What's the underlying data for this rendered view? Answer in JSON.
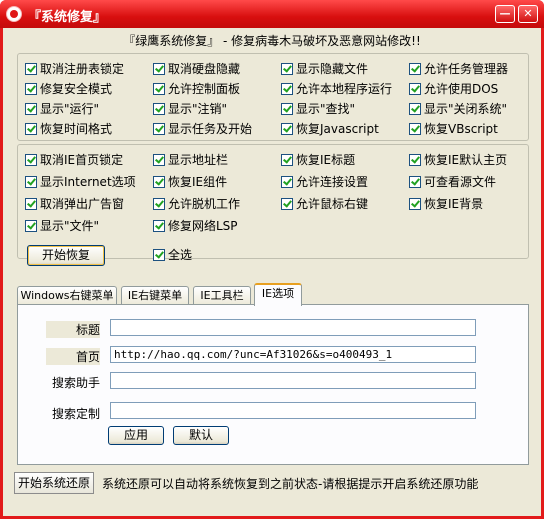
{
  "window": {
    "title": "『系统修复』",
    "minimize": "—",
    "close": "✕"
  },
  "headline": "『绿鹰系统修复』 - 修复病毒木马破坏及恶意网站修改!!",
  "group1": [
    {
      "label": "取消注册表锁定",
      "checked": true
    },
    {
      "label": "取消硬盘隐藏",
      "checked": true
    },
    {
      "label": "显示隐藏文件",
      "checked": true
    },
    {
      "label": "允许任务管理器",
      "checked": true
    },
    {
      "label": "修复安全模式",
      "checked": true
    },
    {
      "label": "允许控制面板",
      "checked": true
    },
    {
      "label": "允许本地程序运行",
      "checked": true
    },
    {
      "label": "允许使用DOS",
      "checked": true
    },
    {
      "label": "显示\"运行\"",
      "checked": true
    },
    {
      "label": "显示\"注销\"",
      "checked": true
    },
    {
      "label": "显示\"查找\"",
      "checked": true
    },
    {
      "label": "显示\"关闭系统\"",
      "checked": true
    },
    {
      "label": "恢复时间格式",
      "checked": true
    },
    {
      "label": "显示任务及开始",
      "checked": true
    },
    {
      "label": "恢复Javascript",
      "checked": true
    },
    {
      "label": "恢复VBscript",
      "checked": true
    }
  ],
  "group2": [
    {
      "label": "取消IE首页锁定",
      "checked": true
    },
    {
      "label": "显示地址栏",
      "checked": true
    },
    {
      "label": "恢复IE标题",
      "checked": true
    },
    {
      "label": "恢复IE默认主页",
      "checked": true
    },
    {
      "label": "显示Internet选项",
      "checked": true
    },
    {
      "label": "恢复IE组件",
      "checked": true
    },
    {
      "label": "允许连接设置",
      "checked": true
    },
    {
      "label": "可查看源文件",
      "checked": true
    },
    {
      "label": "取消弹出广告窗",
      "checked": true
    },
    {
      "label": "允许脱机工作",
      "checked": true
    },
    {
      "label": "允许鼠标右键",
      "checked": true
    },
    {
      "label": "恢复IE背景",
      "checked": true
    },
    {
      "label": "显示\"文件\"",
      "checked": true
    },
    {
      "label": "修复网络LSP",
      "checked": true
    }
  ],
  "actions": {
    "start_restore": "开始恢复",
    "select_all": "全选",
    "select_all_checked": true
  },
  "tabs": [
    {
      "label": "Windows右键菜单",
      "active": false
    },
    {
      "label": "IE右键菜单",
      "active": false
    },
    {
      "label": "IE工具栏",
      "active": false
    },
    {
      "label": "IE选项",
      "active": true
    }
  ],
  "ie_options": {
    "title_label": "标题",
    "title_value": "",
    "homepage_label": "首页",
    "homepage_value": "http://hao.qq.com/?unc=Af31026&s=o400493_1",
    "search_label": "搜索助手",
    "search_value": "",
    "search_custom_label": "搜索定制",
    "search_custom_value": "",
    "apply": "应用",
    "default": "默认"
  },
  "footer": {
    "system_restore_button": "开始系统还原",
    "description": "系统还原可以自动将系统恢复到之前状态-请根据提示开启系统还原功能"
  }
}
